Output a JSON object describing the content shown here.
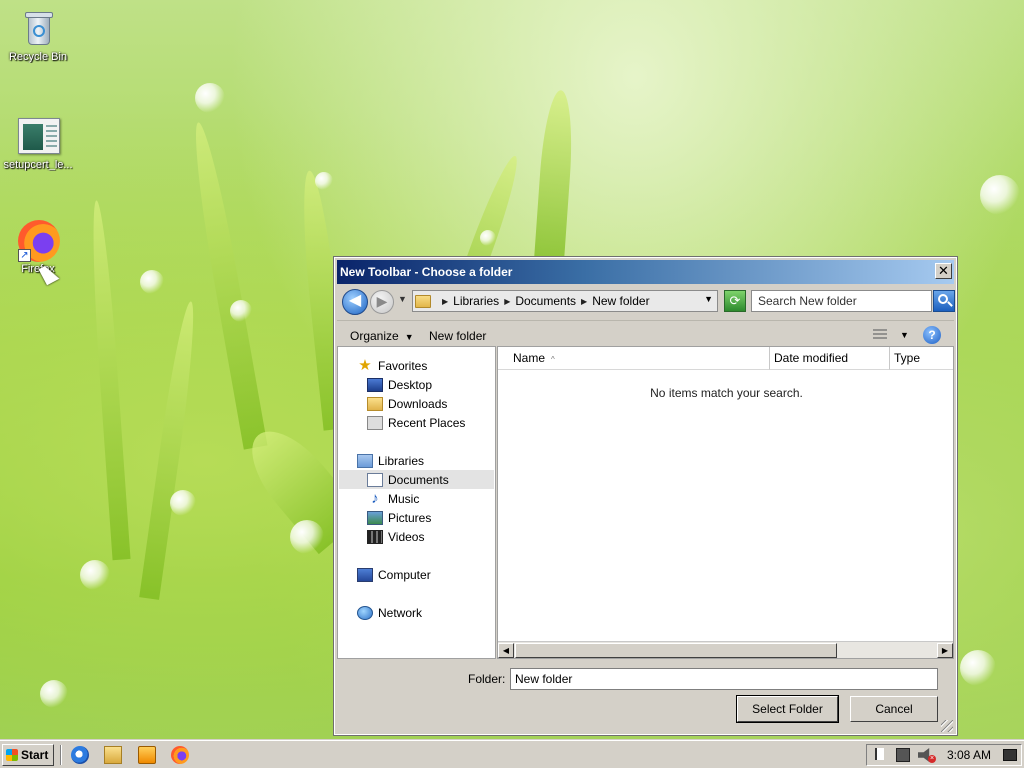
{
  "desktop": {
    "icons": [
      {
        "label": "Recycle Bin",
        "icon": "recycle-bin-icon"
      },
      {
        "label": "setupcert_le...",
        "icon": "installer-icon"
      },
      {
        "label": "Firefox",
        "icon": "firefox-icon"
      }
    ]
  },
  "dialog": {
    "title": "New Toolbar - Choose a folder",
    "close_glyph": "✕",
    "back_glyph": "◀",
    "forward_glyph": "▶",
    "address": {
      "crumbs": [
        "Libraries",
        "Documents",
        "New folder"
      ]
    },
    "search_placeholder": "Search New folder",
    "toolbar": {
      "organize_label": "Organize",
      "new_folder_label": "New folder",
      "help_glyph": "?"
    },
    "nav_pane": {
      "favorites": {
        "label": "Favorites",
        "icon": "star-icon"
      },
      "favorites_items": [
        {
          "label": "Desktop",
          "icon": "desktop-icon"
        },
        {
          "label": "Downloads",
          "icon": "downloads-icon"
        },
        {
          "label": "Recent Places",
          "icon": "recent-places-icon"
        }
      ],
      "libraries": {
        "label": "Libraries",
        "icon": "libraries-icon"
      },
      "library_items": [
        {
          "label": "Documents",
          "icon": "documents-icon",
          "selected": true
        },
        {
          "label": "Music",
          "icon": "music-icon"
        },
        {
          "label": "Pictures",
          "icon": "pictures-icon"
        },
        {
          "label": "Videos",
          "icon": "videos-icon"
        }
      ],
      "computer": {
        "label": "Computer",
        "icon": "computer-icon"
      },
      "network": {
        "label": "Network",
        "icon": "network-icon"
      }
    },
    "file_pane": {
      "columns": [
        "Name",
        "Date modified",
        "Type"
      ],
      "sort_glyph": "^",
      "empty_message": "No items match your search."
    },
    "footer": {
      "folder_label": "Folder:",
      "folder_value": "New folder",
      "select_button": "Select Folder",
      "cancel_button": "Cancel"
    }
  },
  "taskbar": {
    "start_label": "Start",
    "quick_launch": [
      "internet-explorer-icon",
      "windows-explorer-icon",
      "media-player-icon",
      "firefox-icon"
    ],
    "clock": "3:08 AM"
  }
}
